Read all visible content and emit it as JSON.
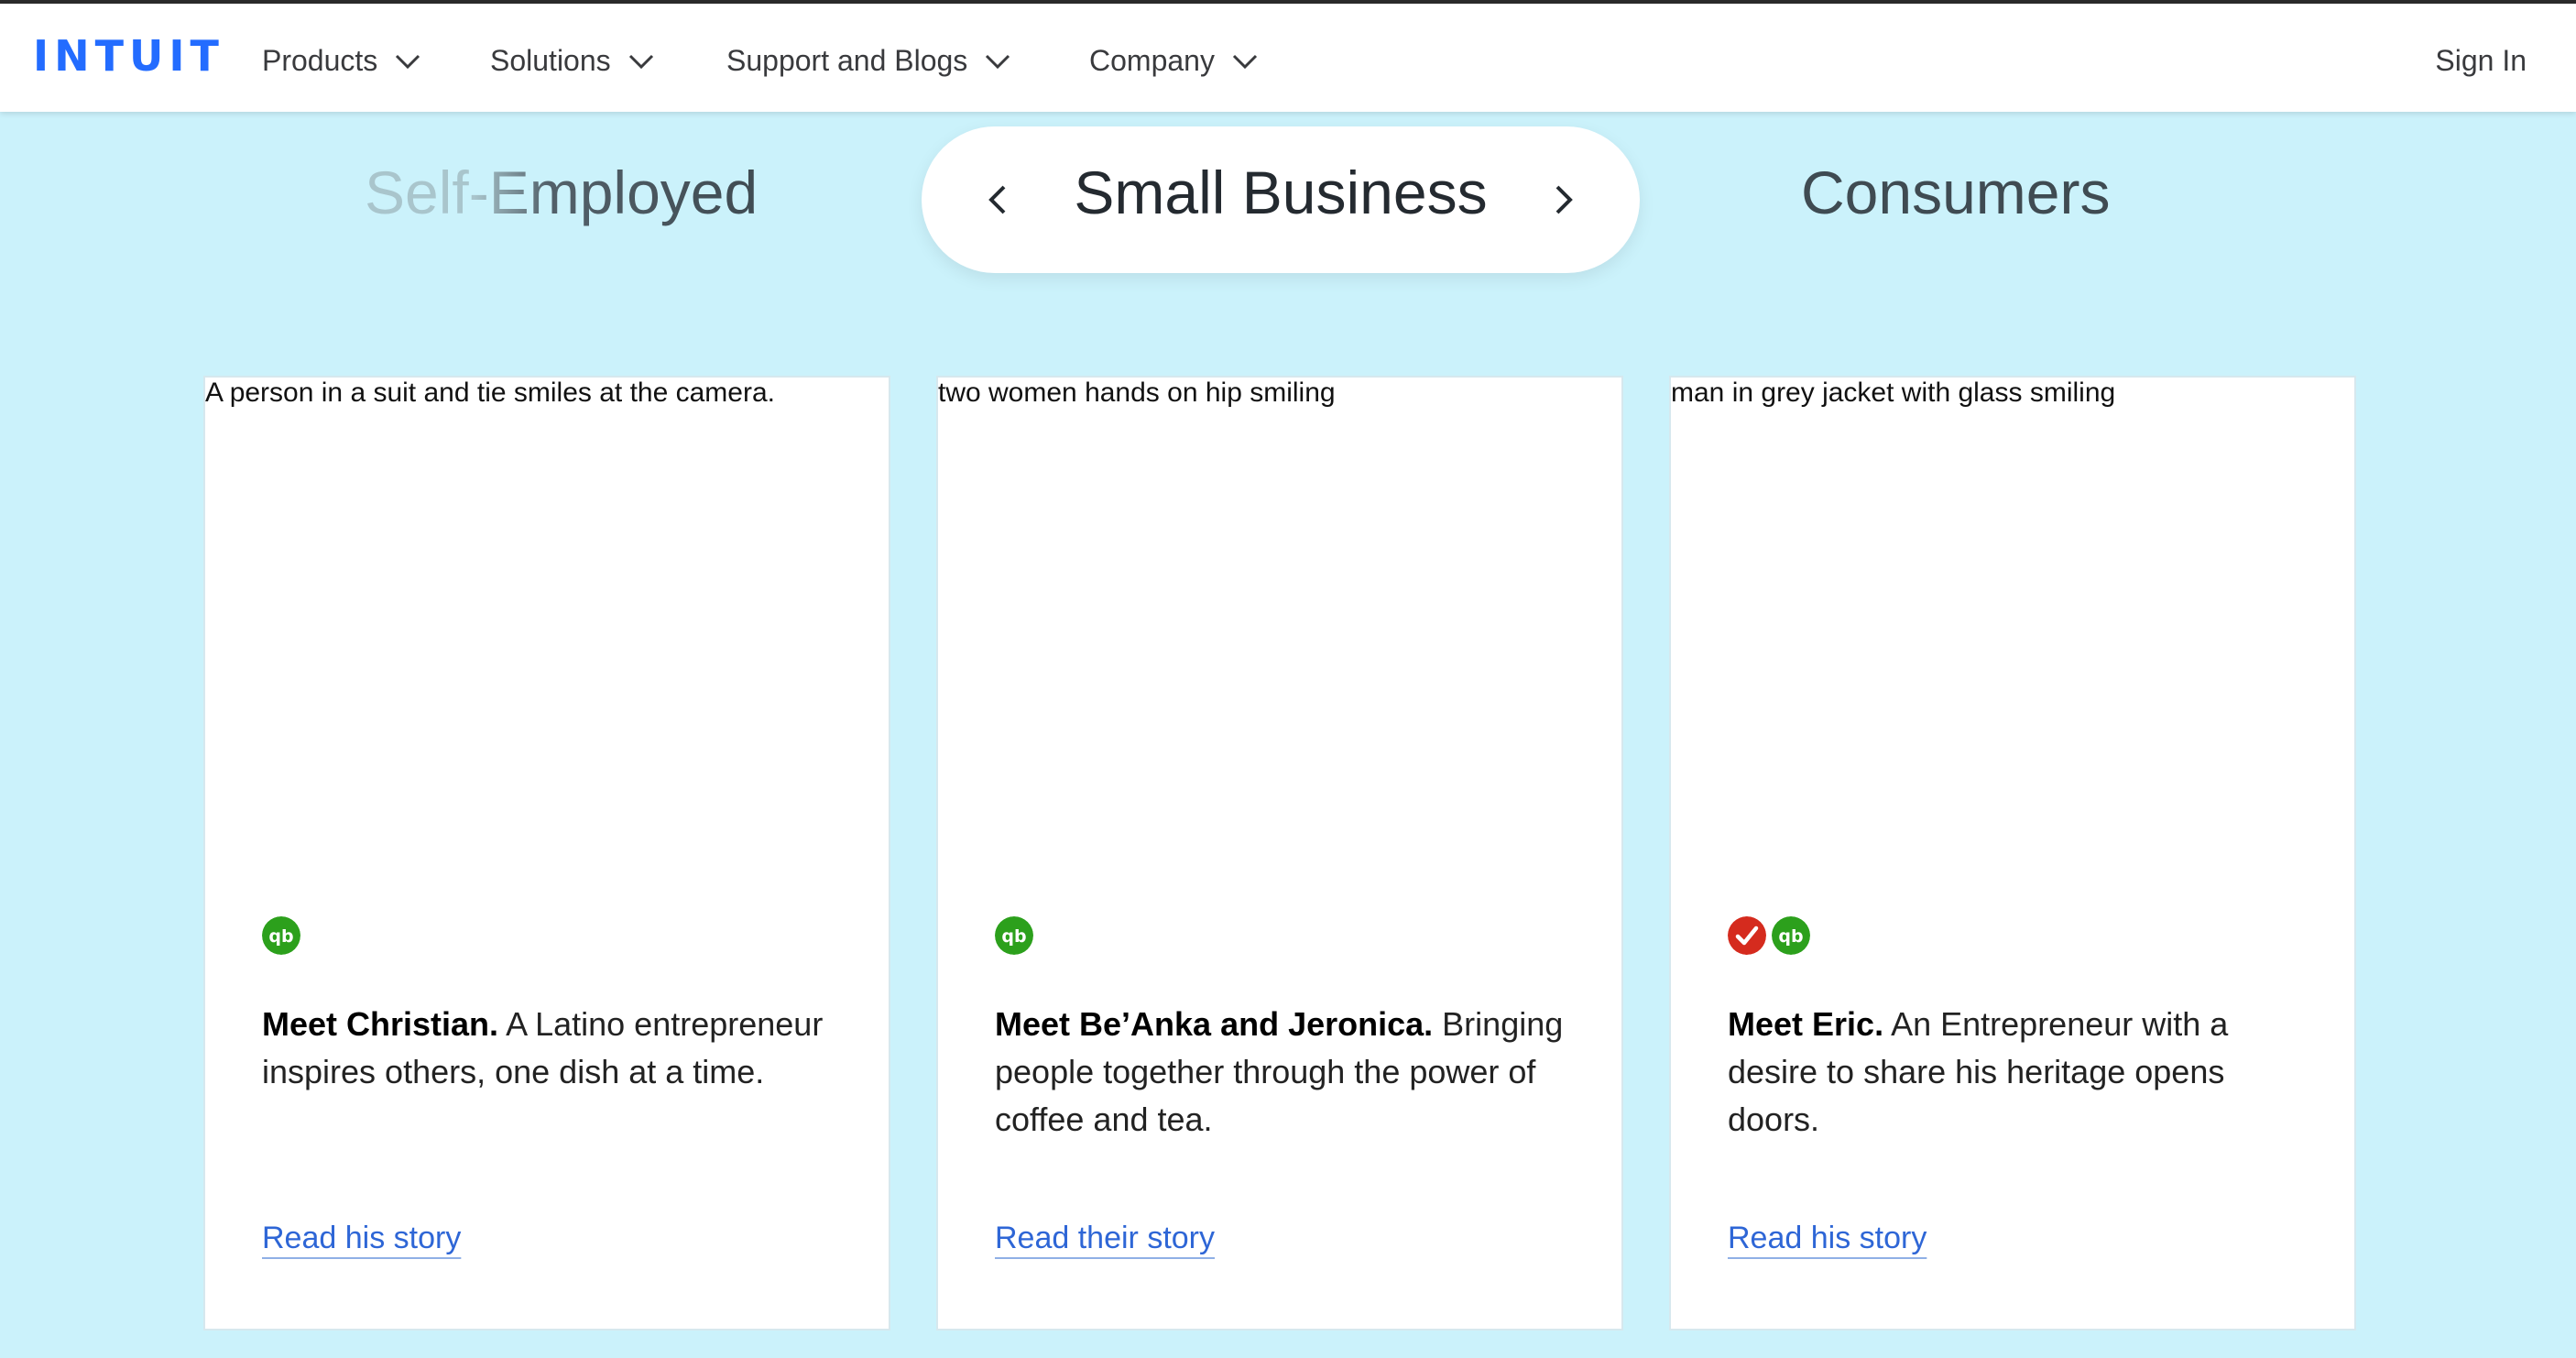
{
  "nav": {
    "logo": "INTUIT",
    "items": [
      {
        "label": "Products"
      },
      {
        "label": "Solutions"
      },
      {
        "label": "Support and Blogs"
      },
      {
        "label": "Company"
      }
    ],
    "sign_in": "Sign In"
  },
  "segments": {
    "left": "Self-Employed",
    "active": "Small Business",
    "right": "Consumers"
  },
  "cards": [
    {
      "alt": "A person in a suit and tie smiles at the camera.",
      "icons": [
        "quickbooks-icon"
      ],
      "title": "Meet Christian.",
      "text": " A Latino entrepreneur inspires others, one dish at a time.",
      "link": "Read his story"
    },
    {
      "alt": "two women hands on hip smiling",
      "icons": [
        "quickbooks-icon"
      ],
      "title": "Meet Be’Anka and Jeronica.",
      "text": " Bringing people together through the power of coffee and tea.",
      "link": "Read their story"
    },
    {
      "alt": "man in grey jacket with glass smiling",
      "icons": [
        "turbotax-icon",
        "quickbooks-icon"
      ],
      "title": "Meet Eric.",
      "text": " An Entrepreneur with a desire to share his heritage opens doors.",
      "link": "Read his story"
    }
  ],
  "colors": {
    "brand": "#236cff",
    "background": "#cbf2fb",
    "link": "#2e66d6",
    "quickbooks": "#2ca01c",
    "turbotax": "#d52b1e"
  }
}
